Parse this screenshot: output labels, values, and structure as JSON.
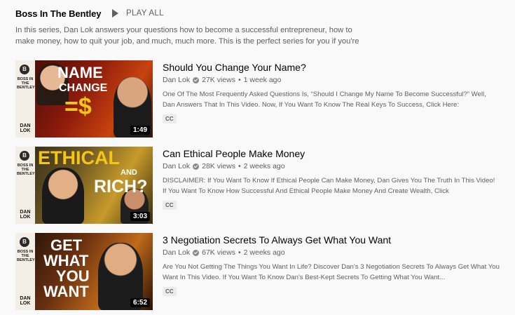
{
  "playlist": {
    "title": "Boss In The Bentley",
    "play_all_label": "PLAY ALL",
    "description": "In this series, Dan Lok answers your questions how to become a successful entrepreneur, how to make money, how to quit your job, and much, much more. This is the perfect series for you if you're"
  },
  "brand": {
    "circle_letter": "B",
    "name": "BOSS IN THE BENTLEY",
    "logo_text": "DAN LOK"
  },
  "videos": [
    {
      "title": "Should You Change Your Name?",
      "channel": "Dan Lok",
      "views": "27K views",
      "age": "1 week ago",
      "description": "One Of The Most Frequently Asked Questions Is, “Should I Change My Name To Become Successful?” Well, Dan Answers That In This Video. Now, If You Want To Know The Real Keys To Success, Click Here:",
      "badge": "CC",
      "duration": "1:49",
      "thumb_text": [
        "NAME",
        "CHANGE",
        "=$"
      ]
    },
    {
      "title": "Can Ethical People Make Money",
      "channel": "Dan Lok",
      "views": "28K views",
      "age": "2 weeks ago",
      "description": "DISCLAIMER: If You Want To Know If Ethical People Can Make Money, Dan Gives You The Truth In This Video! If You Want To Know How Successful And Ethical People Make Money And Create Wealth, Click",
      "badge": "CC",
      "duration": "3:03",
      "thumb_text": [
        "ETHICAL",
        "AND",
        "RICH?"
      ]
    },
    {
      "title": "3 Negotiation Secrets To Always Get What You Want",
      "channel": "Dan Lok",
      "views": "67K views",
      "age": "2 weeks ago",
      "description": "Are You Not Getting The Things You Want In Life? Discover Dan's 3 Negotiation Secrets To Always Get What You Want In This Video. If You Want To Know Dan's Best-Kept Secrets To Getting What You Want...",
      "badge": "CC",
      "duration": "6:52",
      "thumb_text": [
        "GET",
        "WHAT",
        "YOU",
        "WANT"
      ]
    }
  ],
  "meta_separator": "•",
  "colors": {
    "text": "#030303",
    "secondary": "#606060",
    "background": "#f9f9f9"
  },
  "icons": {
    "play": "play-icon",
    "verified": "verified-check-icon"
  }
}
